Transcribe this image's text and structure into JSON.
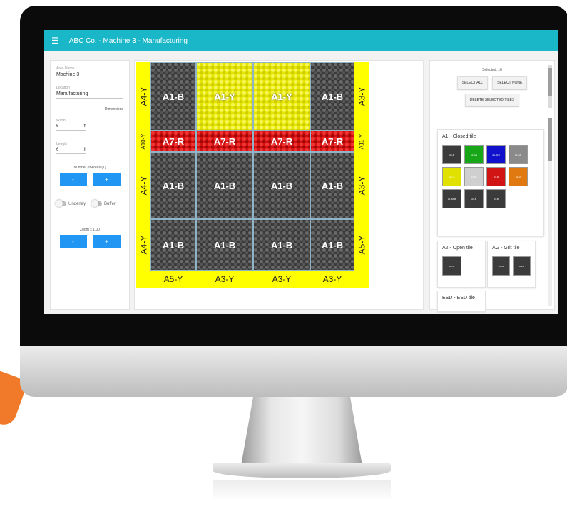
{
  "app": {
    "title": "ABC Co. - Machine 3 - Manufacturing"
  },
  "left": {
    "area_name_label": "Area Name",
    "area_name_value": "Machine 3",
    "location_label": "Location",
    "location_value": "Manufacturing",
    "dimensions_label": "Dimensions",
    "width_label": "Width",
    "width_value": "6",
    "width_unit": "ft",
    "length_label": "Length",
    "length_value": "6",
    "length_unit": "ft",
    "areas_label": "Number of Areas (1)",
    "minus": "-",
    "plus": "+",
    "underlay_label": "Underlay",
    "buffer_label": "Buffer",
    "zoom_label": "Zoom x 1.00"
  },
  "grid": {
    "top_row": [
      "A1-B",
      "A1-Y",
      "A1-Y",
      "A1-B"
    ],
    "red_row": [
      "A7-R",
      "A7-R",
      "A7-R",
      "A7-R"
    ],
    "row3": [
      "A1-B",
      "A1-B",
      "A1-B",
      "A1-B"
    ],
    "row4": [
      "A1-B",
      "A1-B",
      "A1-B",
      "A1-B"
    ],
    "left_edges": [
      "A4-Y",
      "A10-Y",
      "A4-Y",
      "A4-Y"
    ],
    "right_edges": [
      "A3-Y",
      "A11-Y",
      "A3-Y",
      "A5-Y"
    ],
    "bottom_edges": [
      "A5-Y",
      "A3-Y",
      "A3-Y",
      "A3-Y"
    ]
  },
  "right": {
    "selected_label": "Selected: 16",
    "select_all": "SELECT ALL",
    "select_none": "SELECT NONE",
    "delete_selected": "DELETE SELECTED TILES",
    "a1_title": "A1 - Closed tile",
    "a1_swatches": [
      {
        "label": "A1-B",
        "color": "#3b3b3b"
      },
      {
        "label": "A1-GN",
        "color": "#17a617"
      },
      {
        "label": "A1-BLU",
        "color": "#1111cc"
      },
      {
        "label": "A1-GR",
        "color": "#8a8a8a"
      },
      {
        "label": "A1-Y",
        "color": "#e1e100"
      },
      {
        "label": "A1-ST",
        "color": "#cfcfcf"
      },
      {
        "label": "A1-R",
        "color": "#d11515"
      },
      {
        "label": "A1-O",
        "color": "#e07a10"
      },
      {
        "label": "A1-SMB",
        "color": "#3b3b3b"
      },
      {
        "label": "A1-B",
        "color": "#3b3b3b"
      },
      {
        "label": "A1-B",
        "color": "#3b3b3b"
      }
    ],
    "a2_title": "A2 - Open tile",
    "a2_swatch": "A2-B",
    "ag_title": "AG - Grit tile",
    "ag_swatches": [
      "AG-B",
      "AG-R"
    ],
    "esd_title": "ESD - ESD tile"
  }
}
